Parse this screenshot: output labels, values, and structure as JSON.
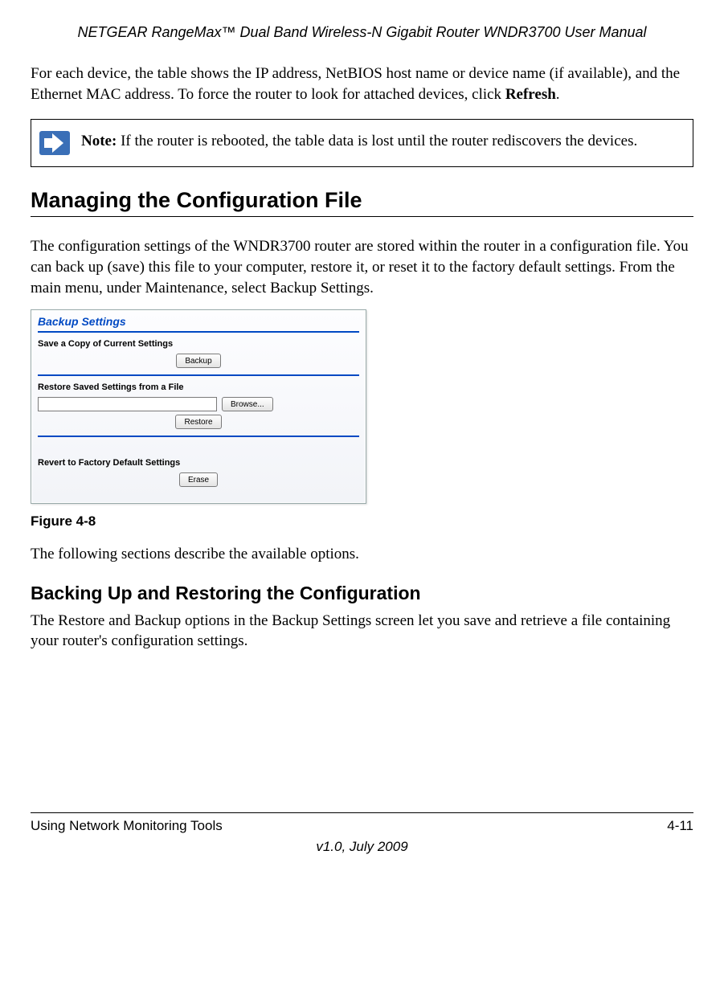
{
  "header": {
    "title": "NETGEAR RangeMax™ Dual Band Wireless-N Gigabit Router WNDR3700 User Manual"
  },
  "intro": {
    "para1_a": "For each device, the table shows the IP address, NetBIOS host name or device name (if available), and the Ethernet MAC address. To force the router to look for attached devices, click ",
    "para1_bold": "Refresh",
    "para1_b": "."
  },
  "note": {
    "label": "Note:",
    "text": " If the router is rebooted, the table data is lost until the router rediscovers the devices."
  },
  "section1": {
    "heading": "Managing the Configuration File",
    "para": "The configuration settings of the WNDR3700 router are stored within the router in a configuration file. You can back up (save) this file to your computer, restore it, or reset it to the factory default settings. From the main menu, under Maintenance, select Backup Settings."
  },
  "screenshot": {
    "title": "Backup Settings",
    "save_label": "Save a Copy of Current Settings",
    "backup_btn": "Backup",
    "restore_label": "Restore Saved Settings from a File",
    "browse_btn": "Browse...",
    "restore_btn": "Restore",
    "revert_label": "Revert to Factory Default Settings",
    "erase_btn": "Erase"
  },
  "figure_caption": "Figure 4-8",
  "after_figure": "The following sections describe the available options.",
  "subsection": {
    "heading": "Backing Up and Restoring the Configuration",
    "para": "The Restore and Backup options in the Backup Settings screen let you save and retrieve a file containing your router's configuration settings."
  },
  "footer": {
    "left": "Using Network Monitoring Tools",
    "right": "4-11",
    "version": "v1.0, July 2009"
  }
}
